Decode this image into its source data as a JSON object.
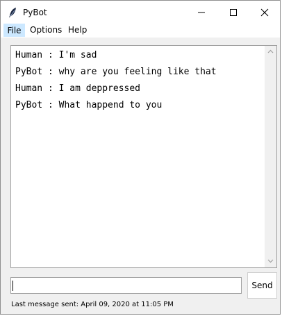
{
  "window": {
    "title": "PyBot"
  },
  "menu": {
    "file": "File",
    "options": "Options",
    "help": "Help"
  },
  "chat": {
    "messages": [
      "Human : I'm sad",
      "PyBot : why are you feeling like that",
      "Human : I am deppressed",
      "PyBot : What happend to you"
    ]
  },
  "input": {
    "value": ""
  },
  "send_label": "Send",
  "status": "Last message sent: April 09, 2020 at 11:05 PM"
}
